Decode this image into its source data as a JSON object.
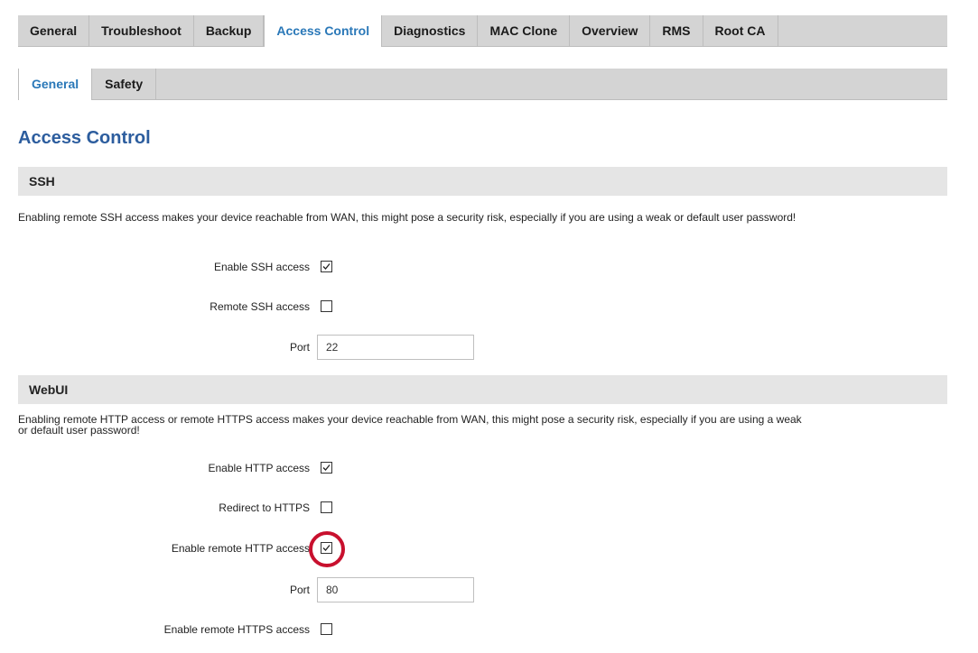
{
  "tabs": [
    "General",
    "Troubleshoot",
    "Backup",
    "Access Control",
    "Diagnostics",
    "MAC Clone",
    "Overview",
    "RMS",
    "Root CA"
  ],
  "active_tab": "Access Control",
  "subtabs": [
    "General",
    "Safety"
  ],
  "active_subtab": "General",
  "page_title": "Access Control",
  "ssh": {
    "header": "SSH",
    "description": "Enabling remote SSH access makes your device reachable from WAN, this might pose a security risk, especially if you are using a weak or default user password!",
    "enable_label": "Enable SSH access",
    "enable_checked": true,
    "remote_label": "Remote SSH access",
    "remote_checked": false,
    "port_label": "Port",
    "port_value": "22"
  },
  "webui": {
    "header": "WebUI",
    "description_line1": "Enabling remote HTTP access or remote HTTPS access makes your device reachable from WAN, this might pose a security risk, especially if you are using a weak",
    "description_line2": "or default user password!",
    "enable_http_label": "Enable HTTP access",
    "enable_http_checked": true,
    "redirect_label": "Redirect to HTTPS",
    "redirect_checked": false,
    "remote_http_label": "Enable remote HTTP access",
    "remote_http_checked": true,
    "port_label": "Port",
    "port_value": "80",
    "remote_https_label": "Enable remote HTTPS access",
    "remote_https_checked": false
  },
  "colors": {
    "accent": "#2a78b8",
    "title": "#2c5d9e",
    "highlight": "#c8102e"
  }
}
